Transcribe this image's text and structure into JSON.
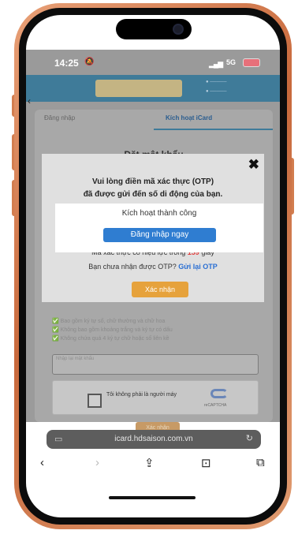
{
  "status_bar": {
    "time": "14:25",
    "network": "5G"
  },
  "tabs": {
    "login": "Đăng nhập",
    "activate": "Kích hoạt iCard"
  },
  "form": {
    "heading": "Đặt mật khẩu",
    "rules": [
      "Bao gồm ký tự số, chữ thường và chữ hoa",
      "Không bao gồm khoảng trắng và ký tự có dấu",
      "Không chứa quá 4 ký tự chữ hoặc số liên kề"
    ],
    "confirm_password_placeholder": "Nhập lại mật khẩu",
    "captcha_label": "Tôi không phải là người máy",
    "captcha_brand": "reCAPTCHA",
    "submit_label": "Xác nhận"
  },
  "otp_dialog": {
    "line1": "Vui lòng điền mã xác thực (OTP)",
    "line2": "đã được gửi đến số di động của bạn.",
    "validity_prefix": "Mã xác thực có hiệu lực trong",
    "validity_seconds": "159",
    "validity_suffix": "giây",
    "resend_prefix": "Bạn chưa nhận được OTP?",
    "resend_link": "Gửi lại OTP",
    "confirm_label": "Xác nhận"
  },
  "success_dialog": {
    "message": "Kích hoạt thành công",
    "login_button": "Đăng nhập ngay"
  },
  "browser": {
    "url": "icard.hdsaison.com.vn"
  }
}
